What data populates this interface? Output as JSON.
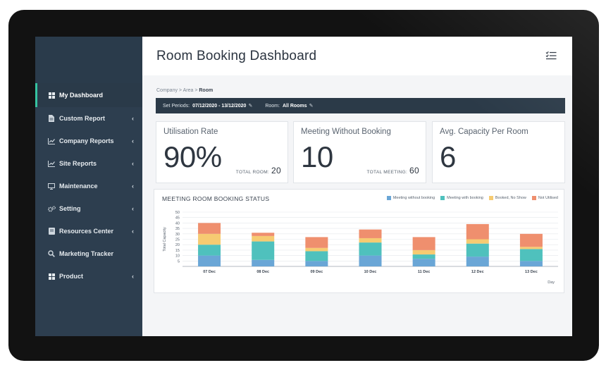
{
  "sidebar": {
    "items": [
      {
        "label": "My Dashboard",
        "icon": "grid-icon",
        "active": true,
        "has_chevron": false
      },
      {
        "label": "Custom Report",
        "icon": "document-icon",
        "active": false,
        "has_chevron": true
      },
      {
        "label": "Company Reports",
        "icon": "line-chart-icon",
        "active": false,
        "has_chevron": true
      },
      {
        "label": "Site Reports",
        "icon": "line-chart-icon",
        "active": false,
        "has_chevron": true
      },
      {
        "label": "Maintenance",
        "icon": "monitor-icon",
        "active": false,
        "has_chevron": true
      },
      {
        "label": "Setting",
        "icon": "gears-icon",
        "active": false,
        "has_chevron": true
      },
      {
        "label": "Resources Center",
        "icon": "book-icon",
        "active": false,
        "has_chevron": true
      },
      {
        "label": "Marketing Tracker",
        "icon": "search-icon",
        "active": false,
        "has_chevron": false
      },
      {
        "label": "Product",
        "icon": "grid-icon",
        "active": false,
        "has_chevron": true
      }
    ]
  },
  "header": {
    "title": "Room Booking Dashboard",
    "menu_icon": "checklist-menu-icon"
  },
  "breadcrumb": {
    "part1": "Company",
    "sep": ">",
    "part2": "Area",
    "current": "Room"
  },
  "filters": {
    "period_label": "Set Periods:",
    "period_value": "07/12/2020 - 13/12/2020",
    "room_label": "Room:",
    "room_value": "All Rooms",
    "edit_icon": "pencil-icon"
  },
  "cards": {
    "utilisation": {
      "title": "Utilisation Rate",
      "value": "90%",
      "sub_label": "TOTAL ROOM:",
      "sub_value": "20"
    },
    "meeting_without_booking": {
      "title": "Meeting Without Booking",
      "value": "10",
      "sub_label": "TOTAL MEETING:",
      "sub_value": "60"
    },
    "avg_capacity": {
      "title": "Avg. Capacity Per Room",
      "value": "6"
    }
  },
  "colors": {
    "meeting_without_booking": "#6aa6d6",
    "meeting_with_booking": "#4fc1bd",
    "booked_no_show": "#f6cb72",
    "not_utilised": "#ef8f6e",
    "accent": "#35c3a0",
    "sidebar_bg": "#2d3e4f"
  },
  "chart_data": {
    "type": "bar",
    "stacked": true,
    "title": "MEETING ROOM BOOKING STATUS",
    "xlabel": "Day",
    "ylabel": "Total Capacity",
    "ylim": [
      0,
      50
    ],
    "yticks": [
      5,
      10,
      15,
      20,
      25,
      30,
      35,
      40,
      45,
      50
    ],
    "grid": true,
    "legend_position": "top-right",
    "categories": [
      "07 Dec",
      "08 Dec",
      "09 Dec",
      "10 Dec",
      "11 Dec",
      "12 Dec",
      "13 Dec"
    ],
    "series": [
      {
        "name": "Meeting without booking",
        "color": "#6aa6d6",
        "values": [
          10,
          6,
          5,
          10,
          7,
          9,
          5
        ]
      },
      {
        "name": "Meeting with booking",
        "color": "#4fc1bd",
        "values": [
          10,
          17,
          9,
          12,
          4,
          12,
          11
        ]
      },
      {
        "name": "Booked, No Show",
        "color": "#f6cb72",
        "values": [
          10,
          5,
          3,
          4,
          4,
          4,
          2
        ]
      },
      {
        "name": "Not Utilised",
        "color": "#ef8f6e",
        "values": [
          10,
          3,
          10,
          8,
          12,
          14,
          12
        ]
      }
    ]
  }
}
